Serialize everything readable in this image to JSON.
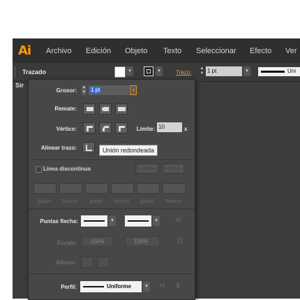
{
  "app": {
    "logo": "Ai"
  },
  "menu": [
    "Archivo",
    "Edición",
    "Objeto",
    "Texto",
    "Seleccionar",
    "Efecto",
    "Ver"
  ],
  "control_bar": {
    "title": "Trazado",
    "stroke_link": "Trazo:",
    "stroke_weight": "1 pt",
    "line_sample_label": "Uni"
  },
  "tab_stub": "Sir",
  "stroke_panel": {
    "weight_label": "Grosor:",
    "weight_value": "1 pt",
    "cap_label": "Remate:",
    "corner_label": "Vértice:",
    "limit_label": "Límite:",
    "limit_value": "10",
    "limit_unit": "x",
    "align_label": "Alinear trazo:",
    "tooltip": "Unión redondeada",
    "dashed_label": "Línea discontinua",
    "dash_captions": [
      "guión",
      "hueco",
      "guión",
      "hueco",
      "guión",
      "hueco"
    ],
    "arrowheads_label": "Puntas flecha:",
    "scale_label": "Escala:",
    "scale_values": [
      "100%",
      "100%"
    ],
    "align_arrow_label": "Alinear:",
    "profile_label": "Perfil:",
    "profile_value": "Uniforme"
  }
}
